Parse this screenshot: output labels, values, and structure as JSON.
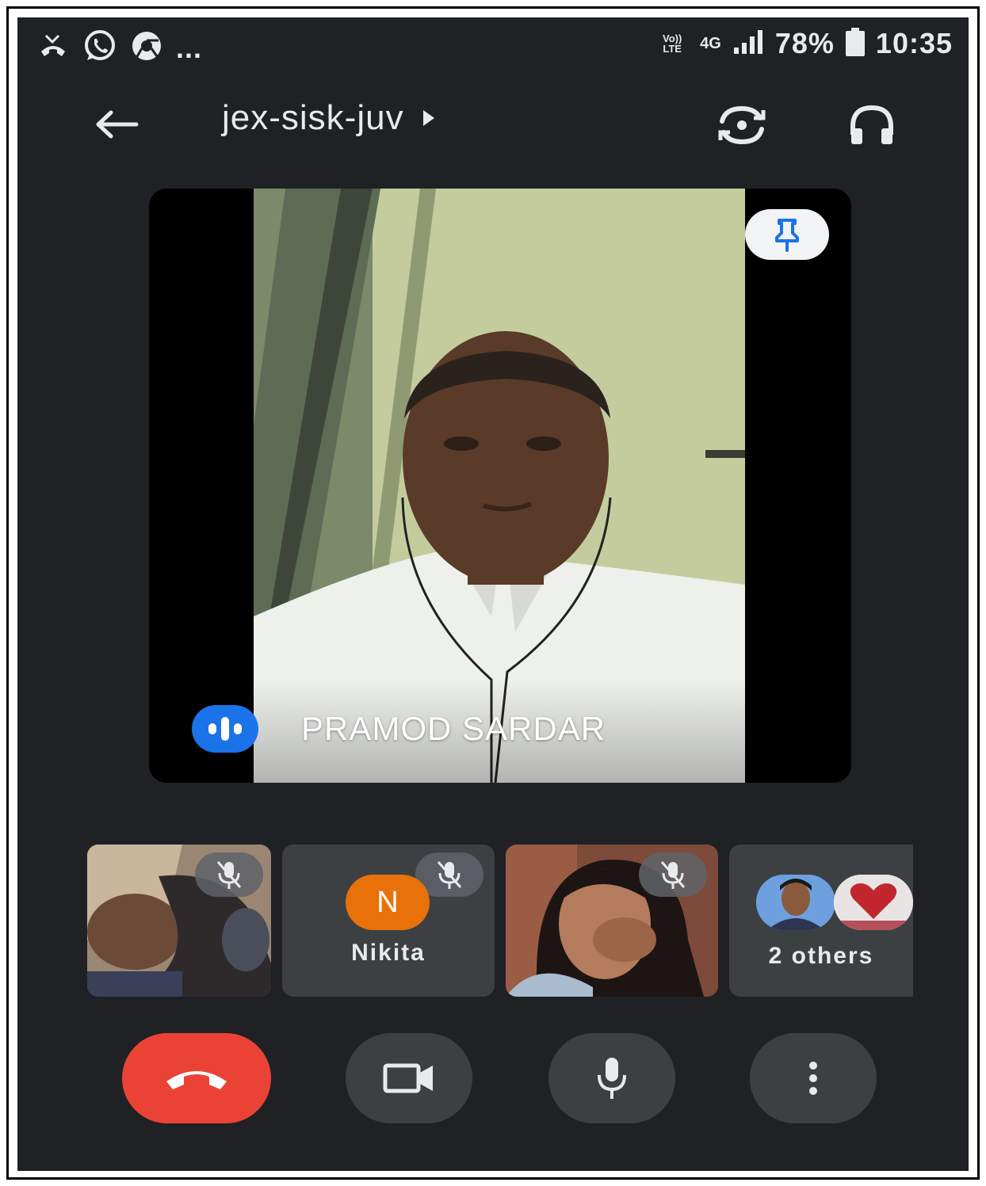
{
  "status_bar": {
    "network_tag": "Vo)) LTE",
    "network_type": "4G",
    "battery": "78%",
    "time": "10:35",
    "overflow": "..."
  },
  "header": {
    "meeting_code": "jex-sisk-juv"
  },
  "main": {
    "participant_name": "PRAMOD SARDAR"
  },
  "thumbnails": [
    {
      "name": "",
      "muted": true
    },
    {
      "name": "Nikita",
      "initial": "N",
      "muted": true,
      "avatar_color": "#e8710a"
    },
    {
      "name": "",
      "muted": true
    },
    {
      "label": "2 others"
    }
  ],
  "controls": {
    "end_call_color": "#ea4335"
  },
  "colors": {
    "background": "#202124",
    "accent": "#1a73e8"
  }
}
